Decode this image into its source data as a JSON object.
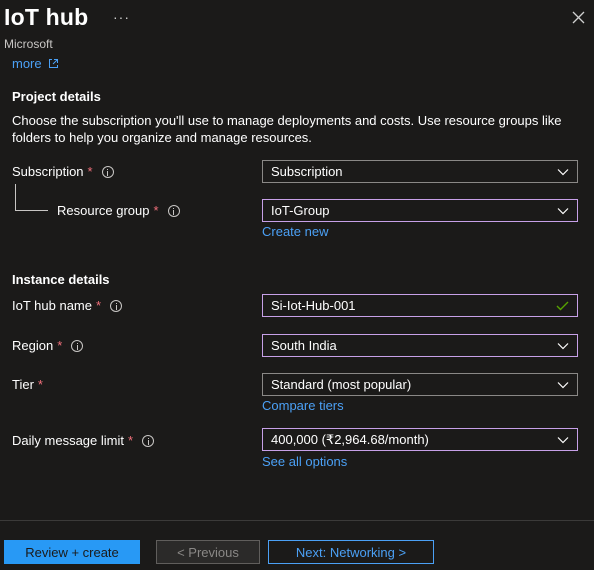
{
  "header": {
    "title": "IoT hub",
    "ellipsis": "···",
    "subtitle": "Microsoft",
    "more_link": "more"
  },
  "project": {
    "heading": "Project details",
    "description": "Choose the subscription you'll use to manage deployments and costs. Use resource groups like folders to help you organize and manage resources.",
    "subscription": {
      "label": "Subscription",
      "required": "*",
      "value": "Subscription"
    },
    "resource_group": {
      "label": "Resource group",
      "required": "*",
      "value": "IoT-Group",
      "create_link": "Create new"
    }
  },
  "instance": {
    "heading": "Instance details",
    "hub_name": {
      "label": "IoT hub name",
      "required": "*",
      "value": "Si-Iot-Hub-001"
    },
    "region": {
      "label": "Region",
      "required": "*",
      "value": "South India"
    },
    "tier": {
      "label": "Tier",
      "required": "*",
      "value": "Standard (most popular)",
      "compare_link": "Compare tiers"
    },
    "daily_limit": {
      "label": "Daily message limit",
      "required": "*",
      "value": "400,000 (₹2,964.68/month)",
      "options_link": "See all options"
    }
  },
  "footer": {
    "review_create": "Review + create",
    "previous": "< Previous",
    "next": "Next: Networking >"
  },
  "colors": {
    "background": "#1b1a19",
    "link": "#4ba0f5",
    "primary_button": "#2899f5",
    "required": "#f1707b",
    "focus_border": "#c7a0e8",
    "valid_check": "#57a300"
  }
}
